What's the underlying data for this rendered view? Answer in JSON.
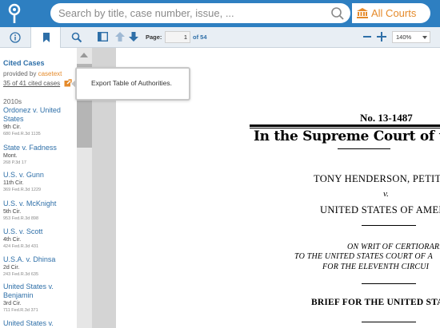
{
  "header": {
    "search_placeholder": "Search by title, case number, issue, ...",
    "courts_label": "All Courts",
    "brand_color": "#2e7fc1",
    "courts_color": "#e58a2a"
  },
  "sidebar_tabs": [
    {
      "icon": "info-icon"
    },
    {
      "icon": "bookmark-icon",
      "active": true
    },
    {
      "icon": "search-icon"
    }
  ],
  "sidebar": {
    "heading": "Cited Cases",
    "provided_by": "provided by",
    "provider": "casetext",
    "count_link": "35 of 41 cited cases",
    "decade": "2010s",
    "cases": [
      {
        "title": "Ordonez v. United States",
        "court": "9th Cir.",
        "cite": "680 Fed.R.3d 1135"
      },
      {
        "title": "State v. Fadness",
        "court": "Mont.",
        "cite": "268 P.3d 17"
      },
      {
        "title": "U.S. v. Gunn",
        "court": "11th Cir.",
        "cite": "369 Fed.R.3d 1229"
      },
      {
        "title": "U.S. v. McKnight",
        "court": "5th Cir.",
        "cite": "953 Fed.R.3d 898"
      },
      {
        "title": "U.S. v. Scott",
        "court": "4th Cir.",
        "cite": "424 Fed.R.3d 431"
      },
      {
        "title": "U.S.A. v. Dhinsa",
        "court": "2d Cir.",
        "cite": "243 Fed.R.3d 635"
      },
      {
        "title": "United States v. Benjamin",
        "court": "3rd Cir.",
        "cite": "711 Fed.R.3d 371"
      },
      {
        "title": "United States v.",
        "court": "",
        "cite": ""
      }
    ]
  },
  "tooltip": {
    "text": "Export Table of Authorities."
  },
  "toolbar": {
    "page_label": "Page:",
    "page_value": "1",
    "page_of": "of 54",
    "zoom": "140%"
  },
  "document": {
    "number": "No. 13-1487",
    "court": "In the Supreme Court of the U",
    "petitioner": "TONY HENDERSON, PETITIO",
    "versus": "v.",
    "respondent": "UNITED STATES OF AMERI",
    "writ_1": "ON WRIT OF CERTIORARI",
    "writ_2": "TO THE UNITED STATES COURT OF A",
    "writ_3": "FOR THE ELEVENTH CIRCUI",
    "brief": "BRIEF FOR THE UNITED STA"
  }
}
